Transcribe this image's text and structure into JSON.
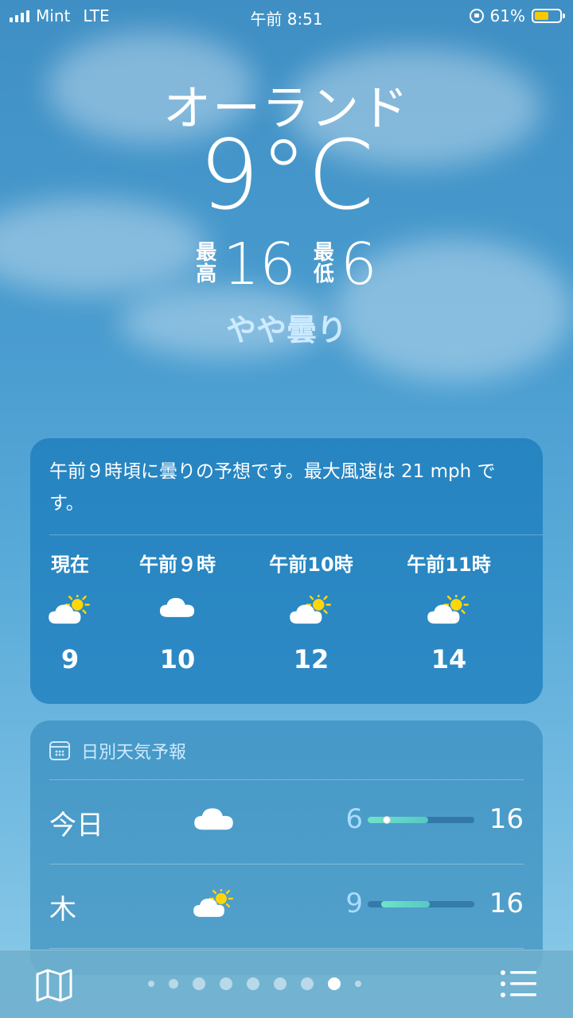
{
  "status_bar": {
    "carrier": "Mint",
    "network": "LTE",
    "time": "午前 8:51",
    "battery_percent": "61%",
    "battery_level": 0.61,
    "battery_color": "#f8c800"
  },
  "location": {
    "city": "オーランド",
    "temperature": "9°C",
    "high_label": "最\n高",
    "high_value": "16",
    "low_label": "最\n低",
    "low_value": "6",
    "condition": "やや曇り"
  },
  "hourly": {
    "summary": "午前９時頃に曇りの予想です。最大風速は 21 mph です。",
    "items": [
      {
        "time": "現在",
        "icon": "partly-sunny-icon",
        "temp": "9"
      },
      {
        "time": "午前９時",
        "icon": "cloud-icon",
        "temp": "10"
      },
      {
        "time": "午前10時",
        "icon": "partly-sunny-icon",
        "temp": "12"
      },
      {
        "time": "午前11時",
        "icon": "partly-sunny-icon",
        "temp": "14"
      }
    ]
  },
  "daily": {
    "header": "日別天気予報",
    "days": [
      {
        "name": "今日",
        "icon": "cloud-icon",
        "low": "6",
        "high": "16",
        "range_start": 0.0,
        "range_end": 0.57,
        "current": 0.18
      },
      {
        "name": "木",
        "icon": "partly-sunny-icon",
        "low": "9",
        "high": "16",
        "range_start": 0.13,
        "range_end": 0.58
      }
    ]
  },
  "pager": {
    "page_count": 9,
    "active_index": 7
  },
  "icons": {
    "map": "map-icon",
    "list": "list-icon"
  }
}
